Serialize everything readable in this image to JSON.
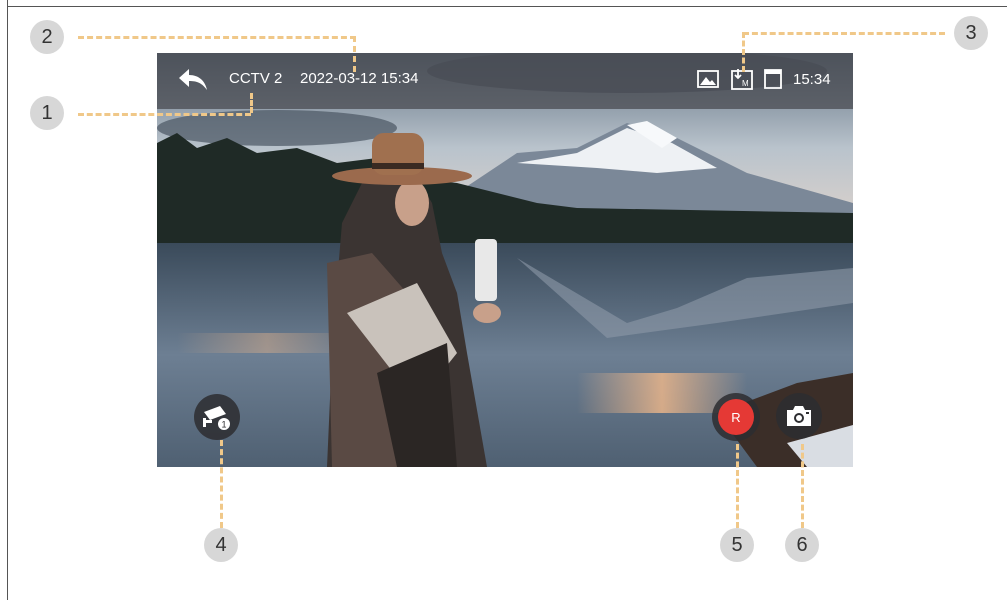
{
  "header": {
    "camera_name": "CCTV 2",
    "datetime": "2022-03-12 15:34",
    "clock": "15:34"
  },
  "icons": {
    "back": "back-arrow-icon",
    "photo": "photo-icon",
    "motion_record": "download-m-icon",
    "sd_card": "sd-card-icon",
    "cctv_switch": "cctv-camera-icon",
    "snapshot": "camera-icon"
  },
  "controls": {
    "record_label": "R",
    "switch_badge": "1"
  },
  "callouts": [
    "1",
    "2",
    "3",
    "4",
    "5",
    "6"
  ],
  "colors": {
    "record": "#e53935",
    "callout_line": "#f0c889",
    "callout_bubble": "#d7d7d7",
    "topbar": "#46484e"
  }
}
